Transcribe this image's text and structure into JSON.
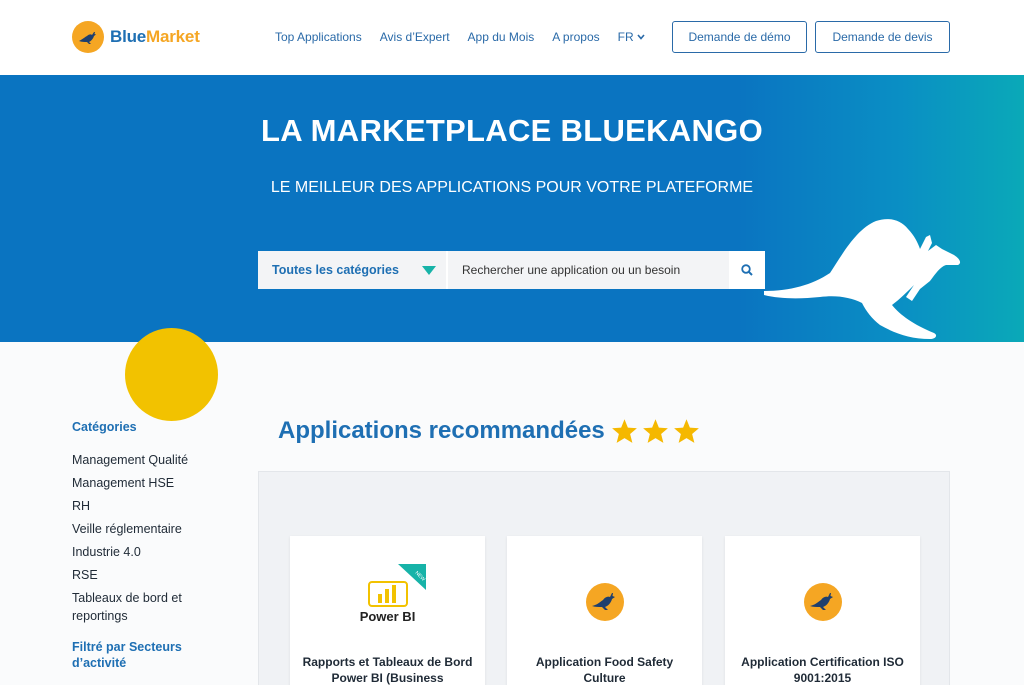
{
  "header": {
    "logo_blue": "Blue",
    "logo_orange": "Market",
    "nav": [
      "Top Applications",
      "Avis d’Expert",
      "App du Mois",
      "A propos"
    ],
    "lang": "FR",
    "demo_button": "Demande de démo",
    "devis_button": "Demande de devis"
  },
  "hero": {
    "title": "LA MARKETPLACE BLUEKANGO",
    "subtitle": "LE MEILLEUR DES APPLICATIONS POUR VOTRE PLATEFORME",
    "category_select": "Toutes les catégories",
    "search_placeholder": "Rechercher une application ou un besoin"
  },
  "sidebar": {
    "categories_heading": "Catégories",
    "categories": [
      "Management Qualité",
      "Management HSE",
      "RH",
      "Veille réglementaire",
      "Industrie 4.0",
      "RSE",
      "Tableaux de bord et reportings"
    ],
    "sectors_heading": "Filtré par Secteurs d’activité"
  },
  "main": {
    "section_title": "Applications recommandées",
    "stars": 3,
    "cards": [
      {
        "title": "Rapports et Tableaux de Bord Power BI (Business",
        "logo_text": "Power BI",
        "badge": "NEW"
      },
      {
        "title": "Application Food Safety Culture"
      },
      {
        "title": "Application Certification ISO 9001:2015"
      }
    ]
  },
  "colors": {
    "brand_blue": "#1e6fb3",
    "hero_blue": "#0a74c1",
    "accent_orange": "#f5a623",
    "accent_yellow": "#f2c200",
    "badge_teal": "#17b3a8"
  }
}
